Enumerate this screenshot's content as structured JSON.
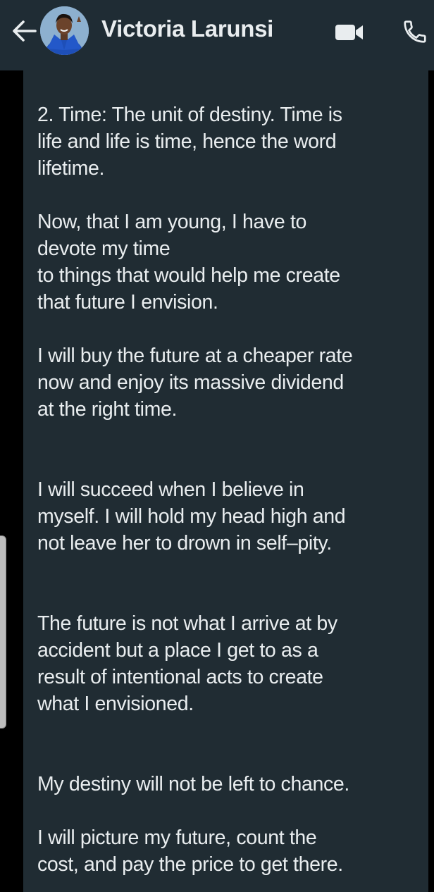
{
  "header": {
    "contact_name": "Victoria Larunsi",
    "back_icon": "arrow-left-icon",
    "video_icon": "video-camera-icon",
    "call_icon": "phone-icon",
    "background": "#1f2c34"
  },
  "message": {
    "background": "#202c33",
    "text_color": "#e9edef",
    "paragraphs": [
      "2. Time: The unit of destiny. Time is\nlife and life is time, hence the word\nlifetime.",
      "Now, that I am young, I  have to\ndevote my time\nto things that would help me create\nthat future I envision.",
      "I will buy the future at a cheaper rate\nnow and enjoy its massive dividend\nat the right time.",
      "I will succeed when I believe in\nmyself. I will hold my head high and\nnot leave her to drown in self–pity.",
      "The future is not what I arrive at by\naccident but a place I get to as a\nresult of intentional acts to create\nwhat I envisioned.",
      "My destiny will not be left to chance.",
      "I will picture my future, count the\ncost, and pay the price to get there."
    ]
  }
}
